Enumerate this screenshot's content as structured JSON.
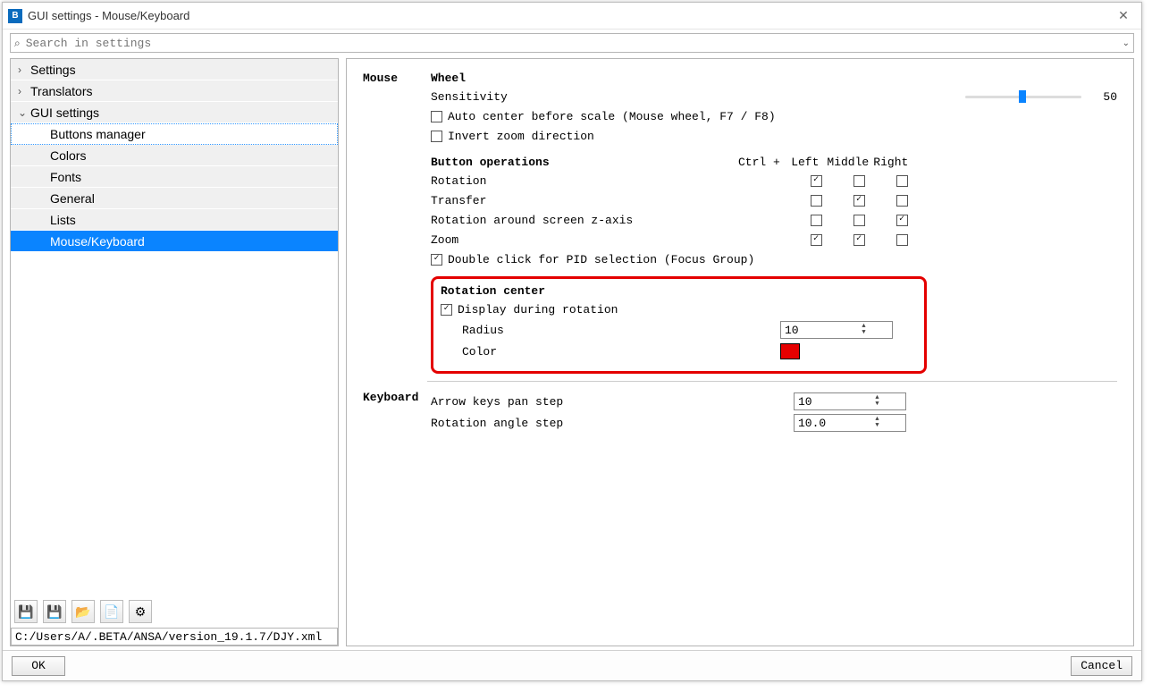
{
  "window": {
    "app_icon_text": "B",
    "title": "GUI settings - Mouse/Keyboard",
    "close_glyph": "✕"
  },
  "search": {
    "icon": "⌕",
    "placeholder": "Search in settings",
    "chevron": "⌄"
  },
  "tree": {
    "settings": "Settings",
    "translators": "Translators",
    "gui": "GUI settings",
    "buttons_manager": "Buttons manager",
    "colors": "Colors",
    "fonts": "Fonts",
    "general": "General",
    "lists": "Lists",
    "mouse_keyboard": "Mouse/Keyboard",
    "exp_closed": "›",
    "exp_open": "⌄"
  },
  "toolbar": {
    "save": "💾",
    "save_edit": "💾",
    "open": "📂",
    "import": "📄",
    "prefs": "⚙"
  },
  "pathbar": "C:/Users/A/.BETA/ANSA/version_19.1.7/DJY.xml",
  "mouse": {
    "section": "Mouse",
    "wheel": "Wheel",
    "sensitivity": "Sensitivity",
    "sensitivity_value": "50",
    "auto_center": "Auto center before scale (Mouse wheel, F7 / F8)",
    "invert": "Invert zoom direction",
    "button_ops": "Button operations",
    "ctrl_plus": "Ctrl +",
    "col_left": "Left",
    "col_middle": "Middle",
    "col_right": "Right",
    "op_rotation": "Rotation",
    "op_transfer": "Transfer",
    "op_rot_z": "Rotation around screen z-axis",
    "op_zoom": "Zoom",
    "dbl_click": "Double click for PID selection (Focus Group)",
    "rot_center": "Rotation center",
    "display_during": "Display during rotation",
    "radius_label": "Radius",
    "radius_value": "10",
    "color_label": "Color",
    "color_value": "#e60000"
  },
  "keyboard": {
    "section": "Keyboard",
    "pan_step": "Arrow keys pan step",
    "pan_step_val": "10",
    "rot_step": "Rotation angle step",
    "rot_step_val": "10.0"
  },
  "footer": {
    "ok": "OK",
    "cancel": "Cancel"
  }
}
